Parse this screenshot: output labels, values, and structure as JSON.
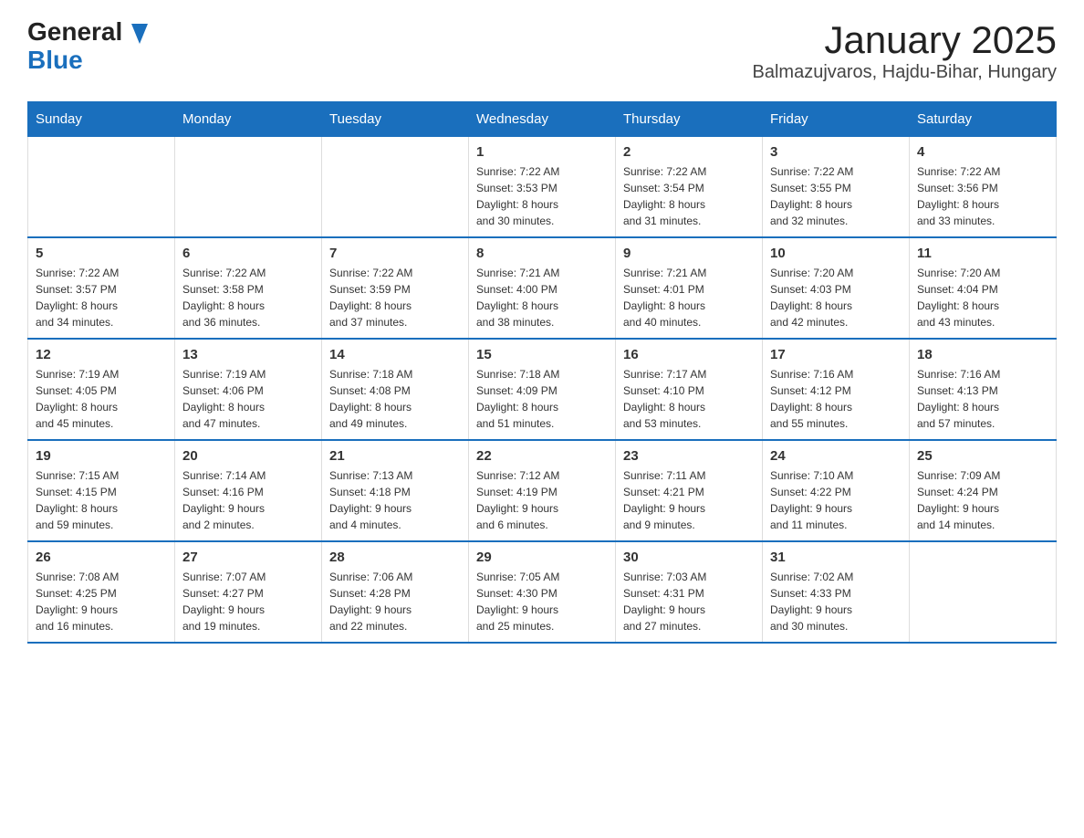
{
  "header": {
    "title": "January 2025",
    "subtitle": "Balmazujvaros, Hajdu-Bihar, Hungary",
    "logo_general": "General",
    "logo_blue": "Blue"
  },
  "weekdays": [
    "Sunday",
    "Monday",
    "Tuesday",
    "Wednesday",
    "Thursday",
    "Friday",
    "Saturday"
  ],
  "weeks": [
    [
      {
        "day": "",
        "info": ""
      },
      {
        "day": "",
        "info": ""
      },
      {
        "day": "",
        "info": ""
      },
      {
        "day": "1",
        "info": "Sunrise: 7:22 AM\nSunset: 3:53 PM\nDaylight: 8 hours\nand 30 minutes."
      },
      {
        "day": "2",
        "info": "Sunrise: 7:22 AM\nSunset: 3:54 PM\nDaylight: 8 hours\nand 31 minutes."
      },
      {
        "day": "3",
        "info": "Sunrise: 7:22 AM\nSunset: 3:55 PM\nDaylight: 8 hours\nand 32 minutes."
      },
      {
        "day": "4",
        "info": "Sunrise: 7:22 AM\nSunset: 3:56 PM\nDaylight: 8 hours\nand 33 minutes."
      }
    ],
    [
      {
        "day": "5",
        "info": "Sunrise: 7:22 AM\nSunset: 3:57 PM\nDaylight: 8 hours\nand 34 minutes."
      },
      {
        "day": "6",
        "info": "Sunrise: 7:22 AM\nSunset: 3:58 PM\nDaylight: 8 hours\nand 36 minutes."
      },
      {
        "day": "7",
        "info": "Sunrise: 7:22 AM\nSunset: 3:59 PM\nDaylight: 8 hours\nand 37 minutes."
      },
      {
        "day": "8",
        "info": "Sunrise: 7:21 AM\nSunset: 4:00 PM\nDaylight: 8 hours\nand 38 minutes."
      },
      {
        "day": "9",
        "info": "Sunrise: 7:21 AM\nSunset: 4:01 PM\nDaylight: 8 hours\nand 40 minutes."
      },
      {
        "day": "10",
        "info": "Sunrise: 7:20 AM\nSunset: 4:03 PM\nDaylight: 8 hours\nand 42 minutes."
      },
      {
        "day": "11",
        "info": "Sunrise: 7:20 AM\nSunset: 4:04 PM\nDaylight: 8 hours\nand 43 minutes."
      }
    ],
    [
      {
        "day": "12",
        "info": "Sunrise: 7:19 AM\nSunset: 4:05 PM\nDaylight: 8 hours\nand 45 minutes."
      },
      {
        "day": "13",
        "info": "Sunrise: 7:19 AM\nSunset: 4:06 PM\nDaylight: 8 hours\nand 47 minutes."
      },
      {
        "day": "14",
        "info": "Sunrise: 7:18 AM\nSunset: 4:08 PM\nDaylight: 8 hours\nand 49 minutes."
      },
      {
        "day": "15",
        "info": "Sunrise: 7:18 AM\nSunset: 4:09 PM\nDaylight: 8 hours\nand 51 minutes."
      },
      {
        "day": "16",
        "info": "Sunrise: 7:17 AM\nSunset: 4:10 PM\nDaylight: 8 hours\nand 53 minutes."
      },
      {
        "day": "17",
        "info": "Sunrise: 7:16 AM\nSunset: 4:12 PM\nDaylight: 8 hours\nand 55 minutes."
      },
      {
        "day": "18",
        "info": "Sunrise: 7:16 AM\nSunset: 4:13 PM\nDaylight: 8 hours\nand 57 minutes."
      }
    ],
    [
      {
        "day": "19",
        "info": "Sunrise: 7:15 AM\nSunset: 4:15 PM\nDaylight: 8 hours\nand 59 minutes."
      },
      {
        "day": "20",
        "info": "Sunrise: 7:14 AM\nSunset: 4:16 PM\nDaylight: 9 hours\nand 2 minutes."
      },
      {
        "day": "21",
        "info": "Sunrise: 7:13 AM\nSunset: 4:18 PM\nDaylight: 9 hours\nand 4 minutes."
      },
      {
        "day": "22",
        "info": "Sunrise: 7:12 AM\nSunset: 4:19 PM\nDaylight: 9 hours\nand 6 minutes."
      },
      {
        "day": "23",
        "info": "Sunrise: 7:11 AM\nSunset: 4:21 PM\nDaylight: 9 hours\nand 9 minutes."
      },
      {
        "day": "24",
        "info": "Sunrise: 7:10 AM\nSunset: 4:22 PM\nDaylight: 9 hours\nand 11 minutes."
      },
      {
        "day": "25",
        "info": "Sunrise: 7:09 AM\nSunset: 4:24 PM\nDaylight: 9 hours\nand 14 minutes."
      }
    ],
    [
      {
        "day": "26",
        "info": "Sunrise: 7:08 AM\nSunset: 4:25 PM\nDaylight: 9 hours\nand 16 minutes."
      },
      {
        "day": "27",
        "info": "Sunrise: 7:07 AM\nSunset: 4:27 PM\nDaylight: 9 hours\nand 19 minutes."
      },
      {
        "day": "28",
        "info": "Sunrise: 7:06 AM\nSunset: 4:28 PM\nDaylight: 9 hours\nand 22 minutes."
      },
      {
        "day": "29",
        "info": "Sunrise: 7:05 AM\nSunset: 4:30 PM\nDaylight: 9 hours\nand 25 minutes."
      },
      {
        "day": "30",
        "info": "Sunrise: 7:03 AM\nSunset: 4:31 PM\nDaylight: 9 hours\nand 27 minutes."
      },
      {
        "day": "31",
        "info": "Sunrise: 7:02 AM\nSunset: 4:33 PM\nDaylight: 9 hours\nand 30 minutes."
      },
      {
        "day": "",
        "info": ""
      }
    ]
  ]
}
